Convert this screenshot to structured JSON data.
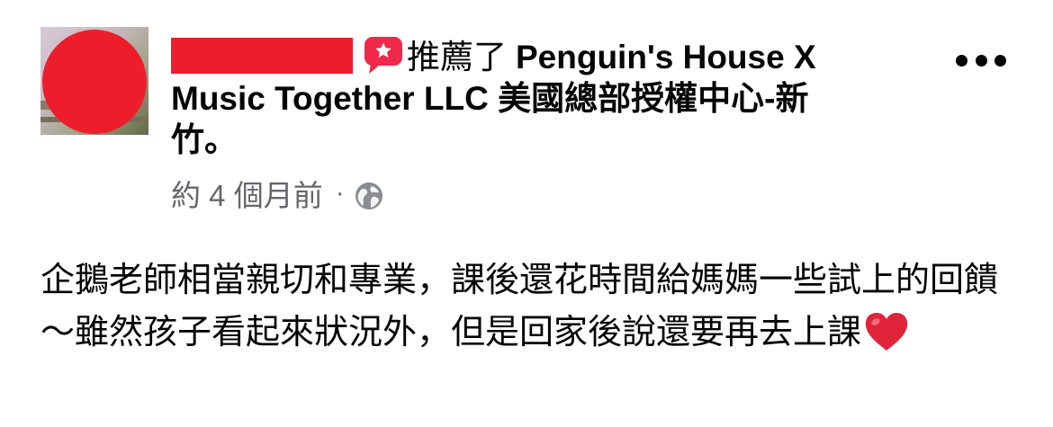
{
  "post": {
    "author_name_redacted": true,
    "action_text": "推薦了",
    "page_name": "Penguin's House X Music Together LLC 美國總部授權中心-新竹。",
    "timestamp": "約 4 個月前",
    "separator": "·",
    "privacy_icon": "globe-icon",
    "recommend_icon": "recommend-badge-icon",
    "body": "企鵝老師相當親切和專業，課後還花時間給媽媽一些試上的回饋～雖然孩子看起來狀況外，但是回家後說還要再去上課",
    "body_emoji": "heart-emoji",
    "more_icon": "more-options-icon"
  },
  "colors": {
    "recommend_red": "#f02849",
    "meta_gray": "#65676b",
    "text": "#050505",
    "redaction": "#ee1d2b"
  }
}
